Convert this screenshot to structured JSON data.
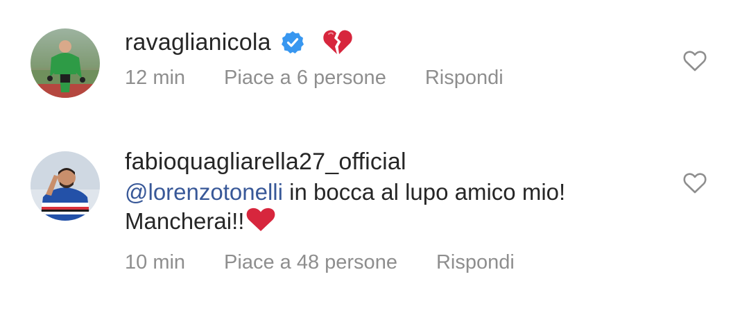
{
  "comments": [
    {
      "username": "ravaglianicola",
      "verified": true,
      "emoji": "broken-heart-icon",
      "text": "",
      "time": "12 min",
      "likes": "Piace a 6 persone",
      "reply": "Rispondi"
    },
    {
      "username": "fabioquagliarella27_official",
      "verified": false,
      "mention": "@lorenzotonelli",
      "text_line1": " in bocca al lupo amico mio!",
      "text_line2": "Mancherai!!",
      "emoji": "red-heart-icon",
      "time": "10 min",
      "likes": "Piace a 48 persone",
      "reply": "Rispondi"
    }
  ],
  "colors": {
    "username": "#262626",
    "meta": "#8e8e8e",
    "mention": "#385898",
    "verified": "#3897f0",
    "heart": "#e0263a"
  }
}
